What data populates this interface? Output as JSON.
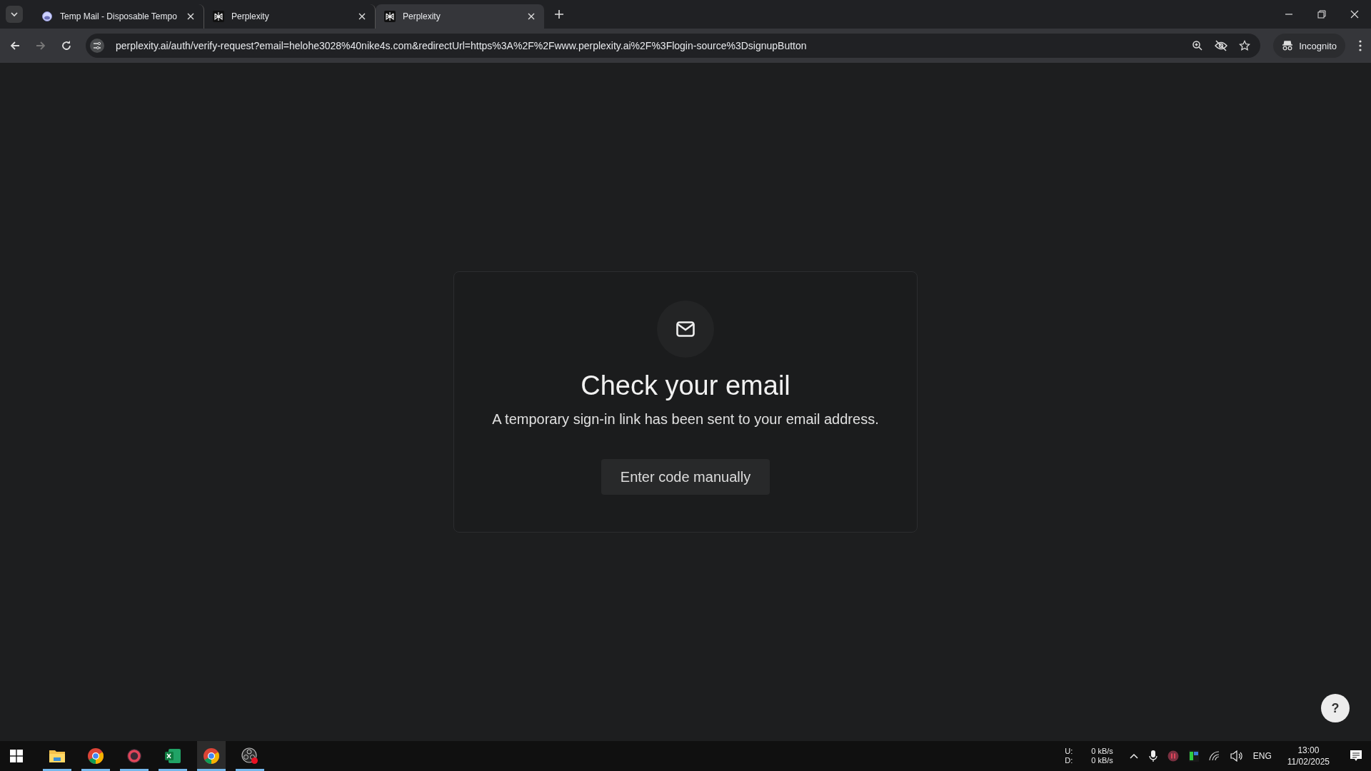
{
  "tabs": [
    {
      "title": "Temp Mail - Disposable Tempo",
      "kind": "tempmail",
      "selected": false
    },
    {
      "title": "Perplexity",
      "kind": "perplexity",
      "selected": false
    },
    {
      "title": "Perplexity",
      "kind": "perplexity",
      "selected": true
    }
  ],
  "address_bar": {
    "url": "perplexity.ai/auth/verify-request?email=helohe3028%40nike4s.com&redirectUrl=https%3A%2F%2Fwww.perplexity.ai%2F%3Flogin-source%3DsignupButton",
    "profile": "Incognito"
  },
  "card": {
    "title": "Check your email",
    "message": "A temporary sign-in link has been sent to your email address.",
    "button": "Enter code manually"
  },
  "help_button": "?",
  "taskbar": {
    "apps": [
      {
        "kind": "files",
        "selected": false
      },
      {
        "kind": "chrome",
        "selected": false
      },
      {
        "kind": "opera",
        "selected": false
      },
      {
        "kind": "excel",
        "selected": false
      },
      {
        "kind": "chrome",
        "selected": true
      },
      {
        "kind": "obs",
        "selected": false
      }
    ],
    "net_labels": [
      "U:",
      "D:"
    ],
    "net_speeds": [
      "0 kB/s",
      "0 kB/s"
    ],
    "language": "ENG",
    "time": "13:00",
    "date": "11/02/2025"
  }
}
